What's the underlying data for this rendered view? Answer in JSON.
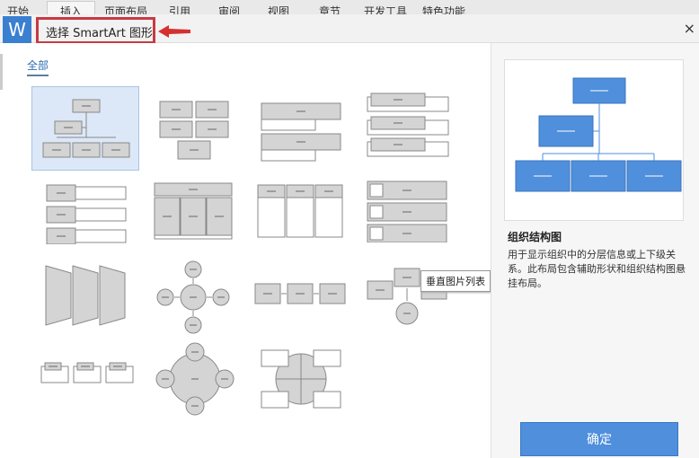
{
  "ribbon": {
    "tabs": [
      "开始",
      "插入",
      "页面布局",
      "引用",
      "审阅",
      "视图",
      "章节",
      "开发工具",
      "特色功能"
    ],
    "active": "插入"
  },
  "dialog": {
    "logo": "W",
    "title": "选择 SmartArt 图形",
    "close": "×"
  },
  "category": "全部",
  "tooltip": "垂直图片列表",
  "preview": {
    "name": "组织结构图",
    "description": "用于显示组织中的分层信息或上下级关系。此布局包含辅助形状和组织结构图悬挂布局。"
  },
  "ok_label": "确定",
  "colors": {
    "accent": "#4f8fdc",
    "shape_fill": "#d4d4d4",
    "annotation": "#c83a44"
  }
}
